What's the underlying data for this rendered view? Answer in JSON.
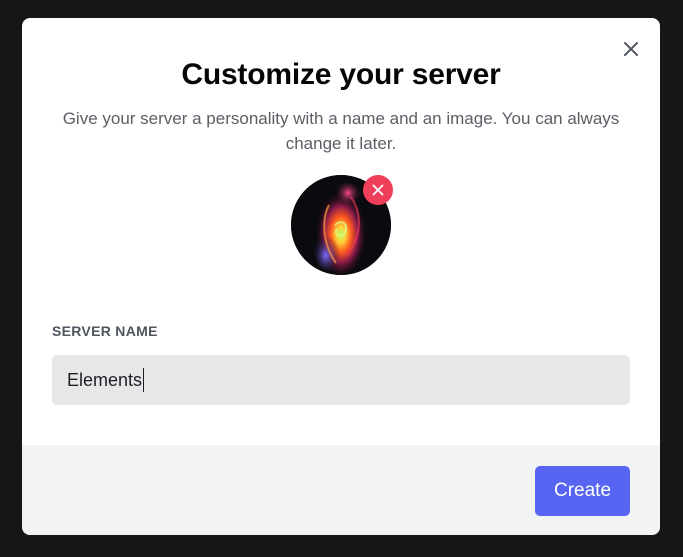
{
  "modal": {
    "title": "Customize your server",
    "subtitle": "Give your server a personality with a name and an image. You can always change it later.",
    "close_icon": "close-icon",
    "avatar_remove_icon": "close-icon"
  },
  "form": {
    "server_name_label": "SERVER NAME",
    "server_name_value": "Elements"
  },
  "footer": {
    "create_label": "Create"
  },
  "colors": {
    "backdrop": "#161616",
    "modal_bg": "#ffffff",
    "footer_bg": "#f2f3f5",
    "input_bg": "#e6e7e9",
    "primary": "#5865f2",
    "remove_badge": "#ee3f5a"
  }
}
